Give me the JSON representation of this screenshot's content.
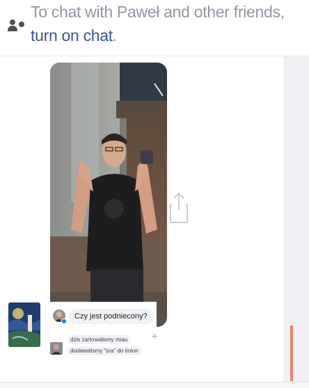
{
  "chat_notice": {
    "line1": "To chat with Paweł and other friends,",
    "link_text": "turn on chat",
    "trailing": ".",
    "icon": "friends-icon"
  },
  "video": {
    "share_icon": "share-icon"
  },
  "comment": {
    "main_text": "Czy jest podniecony?",
    "online_indicator": "online-dot"
  },
  "replies": [
    {
      "text": "dzis zartowalismy miau"
    },
    {
      "text": "dodawalismy \"sra\" do imion"
    }
  ],
  "colors": {
    "link": "#385898",
    "muted_text": "#9097a3",
    "scroll_thumb": "#e8836a",
    "online": "#1877f2"
  }
}
